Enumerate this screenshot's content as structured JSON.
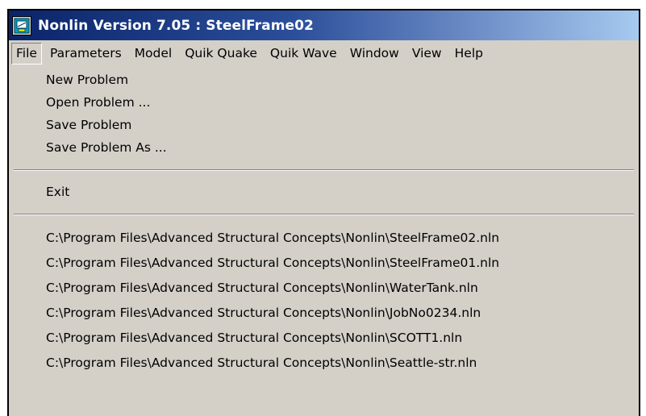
{
  "window": {
    "title": "Nonlin Version 7.05 : SteelFrame02",
    "icon": "app-icon"
  },
  "menubar": {
    "items": [
      {
        "label": "File",
        "open": true
      },
      {
        "label": "Parameters"
      },
      {
        "label": "Model"
      },
      {
        "label": "Quik Quake"
      },
      {
        "label": "Quik Wave"
      },
      {
        "label": "Window"
      },
      {
        "label": "View"
      },
      {
        "label": "Help"
      }
    ]
  },
  "file_menu": {
    "items": [
      {
        "label": "New Problem"
      },
      {
        "label": "Open Problem ..."
      },
      {
        "label": "Save Problem"
      },
      {
        "label": "Save Problem As ..."
      }
    ],
    "exit_label": "Exit",
    "recent_files": [
      "C:\\Program Files\\Advanced Structural Concepts\\Nonlin\\SteelFrame02.nln",
      "C:\\Program Files\\Advanced Structural Concepts\\Nonlin\\SteelFrame01.nln",
      "C:\\Program Files\\Advanced Structural Concepts\\Nonlin\\WaterTank.nln",
      "C:\\Program Files\\Advanced Structural Concepts\\Nonlin\\JobNo0234.nln",
      "C:\\Program Files\\Advanced Structural Concepts\\Nonlin\\SCOTT1.nln",
      "C:\\Program Files\\Advanced Structural Concepts\\Nonlin\\Seattle-str.nln"
    ]
  },
  "colors": {
    "titlebar_start": "#0a246a",
    "titlebar_end": "#a6caf0",
    "face": "#d4d0c8"
  }
}
